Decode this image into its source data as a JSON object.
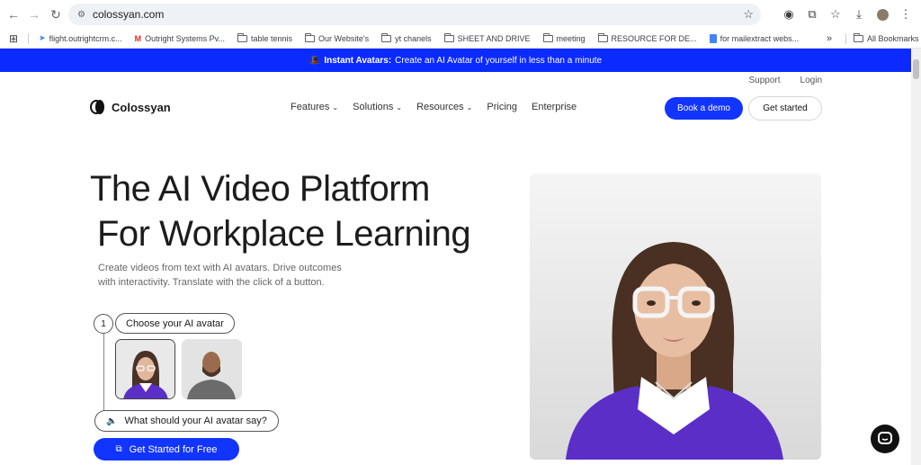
{
  "browser": {
    "url": "colossyan.com",
    "bookmarks": [
      "flight.outrightcrm.c...",
      "Outright Systems Pv...",
      "table tennis",
      "Our Website's",
      "yt chanels",
      "SHEET AND DRIVE",
      "meeting",
      "RESOURCE FOR DE...",
      "for mailextract webs..."
    ],
    "more": "»",
    "all_bookmarks": "All Bookmarks"
  },
  "banner": {
    "emoji": "🎩",
    "bold": "Instant Avatars:",
    "text": "Create an AI Avatar of yourself in less than a minute"
  },
  "header": {
    "support": "Support",
    "login": "Login",
    "logo": "Colossyan",
    "nav": [
      "Features",
      "Solutions",
      "Resources",
      "Pricing",
      "Enterprise"
    ],
    "book_demo": "Book a demo",
    "get_started": "Get started"
  },
  "hero": {
    "title_line1": "The AI Video Platform",
    "title_line2": "For Workplace Learning",
    "subtitle_line1": "Create videos from text with AI avatars. Drive outcomes",
    "subtitle_line2": "with interactivity. Translate with the click of a button.",
    "step_number": "1",
    "step_label": "Choose your AI avatar",
    "say_label": "What should your AI avatar say?",
    "cta": "Get Started for Free"
  },
  "colors": {
    "brand_blue": "#1234ff",
    "banner_blue": "#0b2aff"
  }
}
